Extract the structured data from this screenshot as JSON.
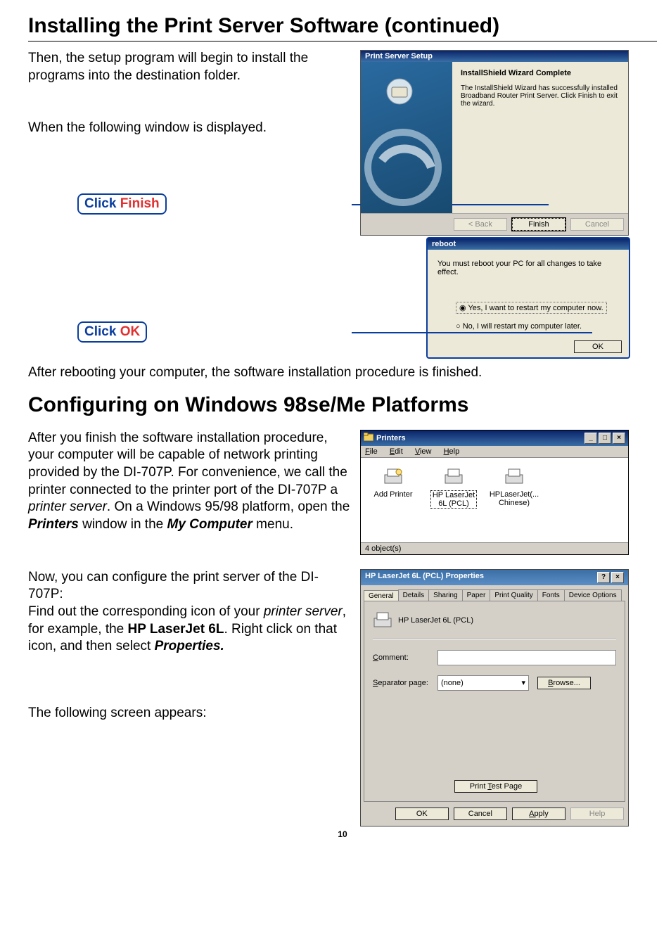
{
  "page": {
    "number": "10"
  },
  "titles": {
    "main": "Installing the Print Server Software (continued)",
    "section2": "Configuring on Windows 98se/Me Platforms"
  },
  "paras": {
    "p1": "Then, the setup program will begin to install the programs into the destination folder.",
    "p2": "When the following window is displayed.",
    "p3": "After rebooting your computer, the software installation procedure is finished.",
    "p4a": "After you finish the software installation procedure, your computer will be capable of network printing provided by the DI-707P. For convenience, we call the printer connected to the printer port of the DI-707P a ",
    "p4b": "printer server",
    "p4c": ". On a Windows 95/98 platform, open the ",
    "p4d": "Printers",
    "p4e": " window in the ",
    "p4f": "My Computer",
    "p4g": " menu.",
    "p5a": "Now, you can configure the print server of the DI-707P:",
    "p5b": "Find out the corresponding icon of your ",
    "p5c": "printer server",
    "p5d": ", for example, the ",
    "p5e": "HP LaserJet 6L",
    "p5f": ". Right click on that icon, and then select ",
    "p5g": "Properties.",
    "p6": "The following screen appears:"
  },
  "callouts": {
    "finish_pre": "Click ",
    "finish_word": "Finish",
    "ok_pre": "Click ",
    "ok_word": "OK"
  },
  "wizard": {
    "title": "Print Server Setup",
    "heading": "InstallShield Wizard Complete",
    "text": "The InstallShield Wizard has successfully installed Broadband Router Print Server.  Click Finish to exit the wizard.",
    "back": "< Back",
    "finish": "Finish",
    "cancel": "Cancel"
  },
  "reboot": {
    "title": "reboot",
    "text": "You must reboot your PC for all changes to take effect.",
    "opt1": "Yes, I want to restart my computer now.",
    "opt2": "No, I will restart my computer later.",
    "ok": "OK"
  },
  "printers": {
    "title": "Printers",
    "menu_file": "File",
    "menu_edit": "Edit",
    "menu_view": "View",
    "menu_help": "Help",
    "add": "Add Printer",
    "p1a": "HP LaserJet",
    "p1b": "6L (PCL)",
    "p2a": "HPLaserJet(...",
    "p2b": "Chinese)",
    "status": "4 object(s)"
  },
  "props": {
    "title": "HP LaserJet 6L (PCL) Properties",
    "tabs": [
      "General",
      "Details",
      "Sharing",
      "Paper",
      "Print Quality",
      "Fonts",
      "Device Options"
    ],
    "printer_name": "HP LaserJet 6L (PCL)",
    "comment_label": "Comment:",
    "sep_label": "Separator page:",
    "sep_value": "(none)",
    "browse": "Browse...",
    "test": "Print Test Page",
    "ok": "OK",
    "cancel": "Cancel",
    "apply": "Apply",
    "help": "Help"
  }
}
